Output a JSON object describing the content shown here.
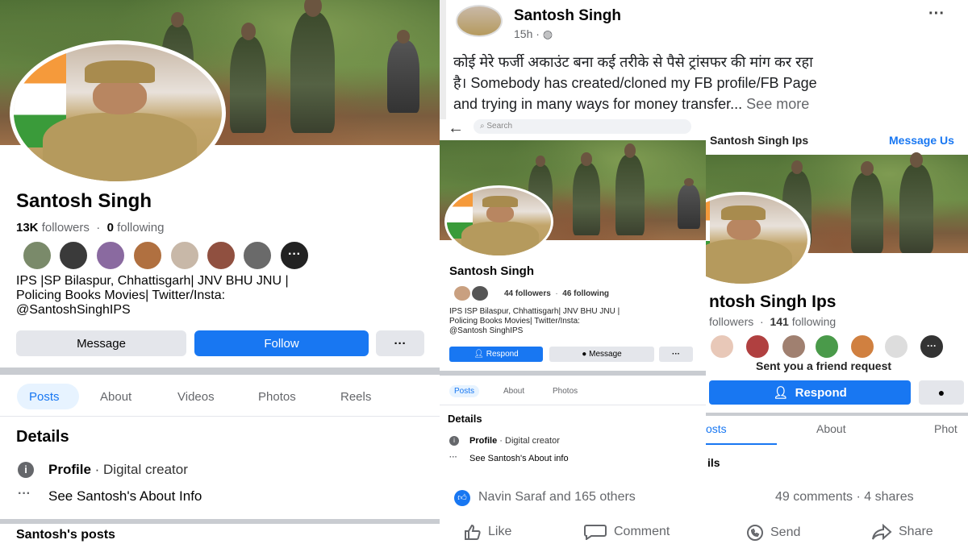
{
  "left": {
    "name": "Santosh Singh",
    "followers_count": "13K",
    "followers_label": "followers",
    "following_count": "0",
    "following_label": "following",
    "bio": [
      "IPS |SP Bilaspur, Chhattisgarh| JNV BHU JNU |",
      "Policing Books Movies| Twitter/Insta:",
      "@SantoshSinghIPS"
    ],
    "message_label": "Message",
    "follow_label": "Follow",
    "tabs": [
      "Posts",
      "About",
      "Videos",
      "Photos",
      "Reels"
    ],
    "details_heading": "Details",
    "profile_bold": "Profile",
    "profile_rest": " · Digital creator",
    "about_info": "See Santosh's About Info",
    "posts_heading": "Santosh's posts"
  },
  "post": {
    "author": "Santosh Singh",
    "time": "15h ·",
    "text_hindi": "कोई मेरे फर्जी अकाउंट बना कई तरीके से पैसे ट्रांसफर की मांग कर रहा",
    "text_line2": "है। Somebody has created/cloned my FB profile/FB Page",
    "text_line3": "and trying in many ways for money transfer...",
    "see_more": "See more",
    "reactions": "Navin Saraf and 165 others",
    "comments_shares": "49 comments · 4 shares",
    "actions": [
      "Like",
      "Comment",
      "Send",
      "Share"
    ]
  },
  "mid": {
    "search_placeholder": "Search",
    "name": "Santosh Singh",
    "followers": "44 followers",
    "following": "46 following",
    "bio": [
      "IPS ISP Bilaspur, Chhattisgarh| JNV BHU JNU |",
      "Policing Books Movies| Twitter/Insta:",
      "@Santosh SinghIPS"
    ],
    "respond_label": "Respond",
    "message_label": "Message",
    "tabs": [
      "Posts",
      "About",
      "Photos"
    ],
    "details_heading": "Details",
    "profile_bold": "Profile",
    "profile_rest": " · Digital creator",
    "about_info": "See Santosh's About info"
  },
  "right": {
    "header_name": "Santosh Singh Ips",
    "header_action": "Message Us",
    "name": "ntosh Singh Ips",
    "followers_label": "followers",
    "following_count": "141",
    "following_label": "following",
    "friend_request": "Sent you a friend request",
    "respond_label": "Respond",
    "tabs": [
      "osts",
      "About",
      "Phot"
    ],
    "details_partial": "ils"
  },
  "colors": {
    "accent": "#1877f2",
    "tab_active_bg": "#e7f3ff"
  }
}
